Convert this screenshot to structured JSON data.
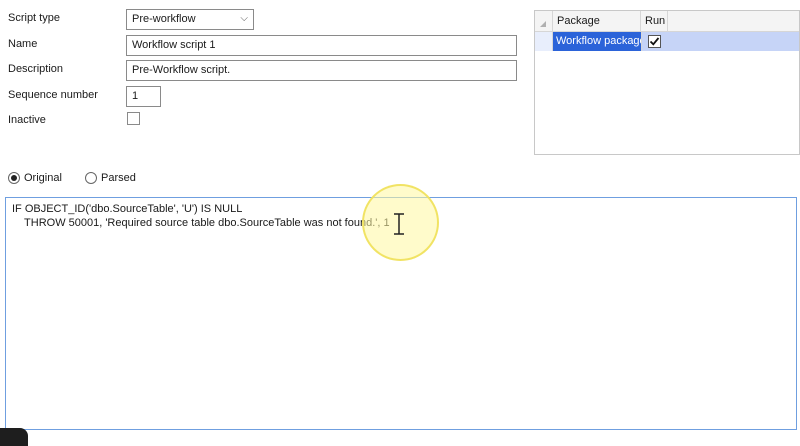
{
  "form": {
    "script_type_label": "Script type",
    "script_type_value": "Pre-workflow",
    "name_label": "Name",
    "name_value": "Workflow script 1",
    "description_label": "Description",
    "description_value": "Pre-Workflow script.",
    "sequence_label": "Sequence number",
    "sequence_value": "1",
    "inactive_label": "Inactive",
    "inactive_checked": false
  },
  "package_grid": {
    "columns": [
      "Package",
      "Run"
    ],
    "rows": [
      {
        "package": "Workflow package",
        "run": true
      }
    ]
  },
  "view_mode": {
    "options": [
      "Original",
      "Parsed"
    ],
    "selected": "Original"
  },
  "script_editor": {
    "lines": [
      "IF OBJECT_ID('dbo.SourceTable', 'U') IS NULL",
      "    THROW 50001, 'Required source table dbo.SourceTable was not found.', 1"
    ]
  },
  "colors": {
    "selection_blue": "#2b63d9",
    "row_highlight": "#c6d4f7",
    "editor_border": "#6f9fe0",
    "cursor_highlight": "#fff8a0"
  }
}
